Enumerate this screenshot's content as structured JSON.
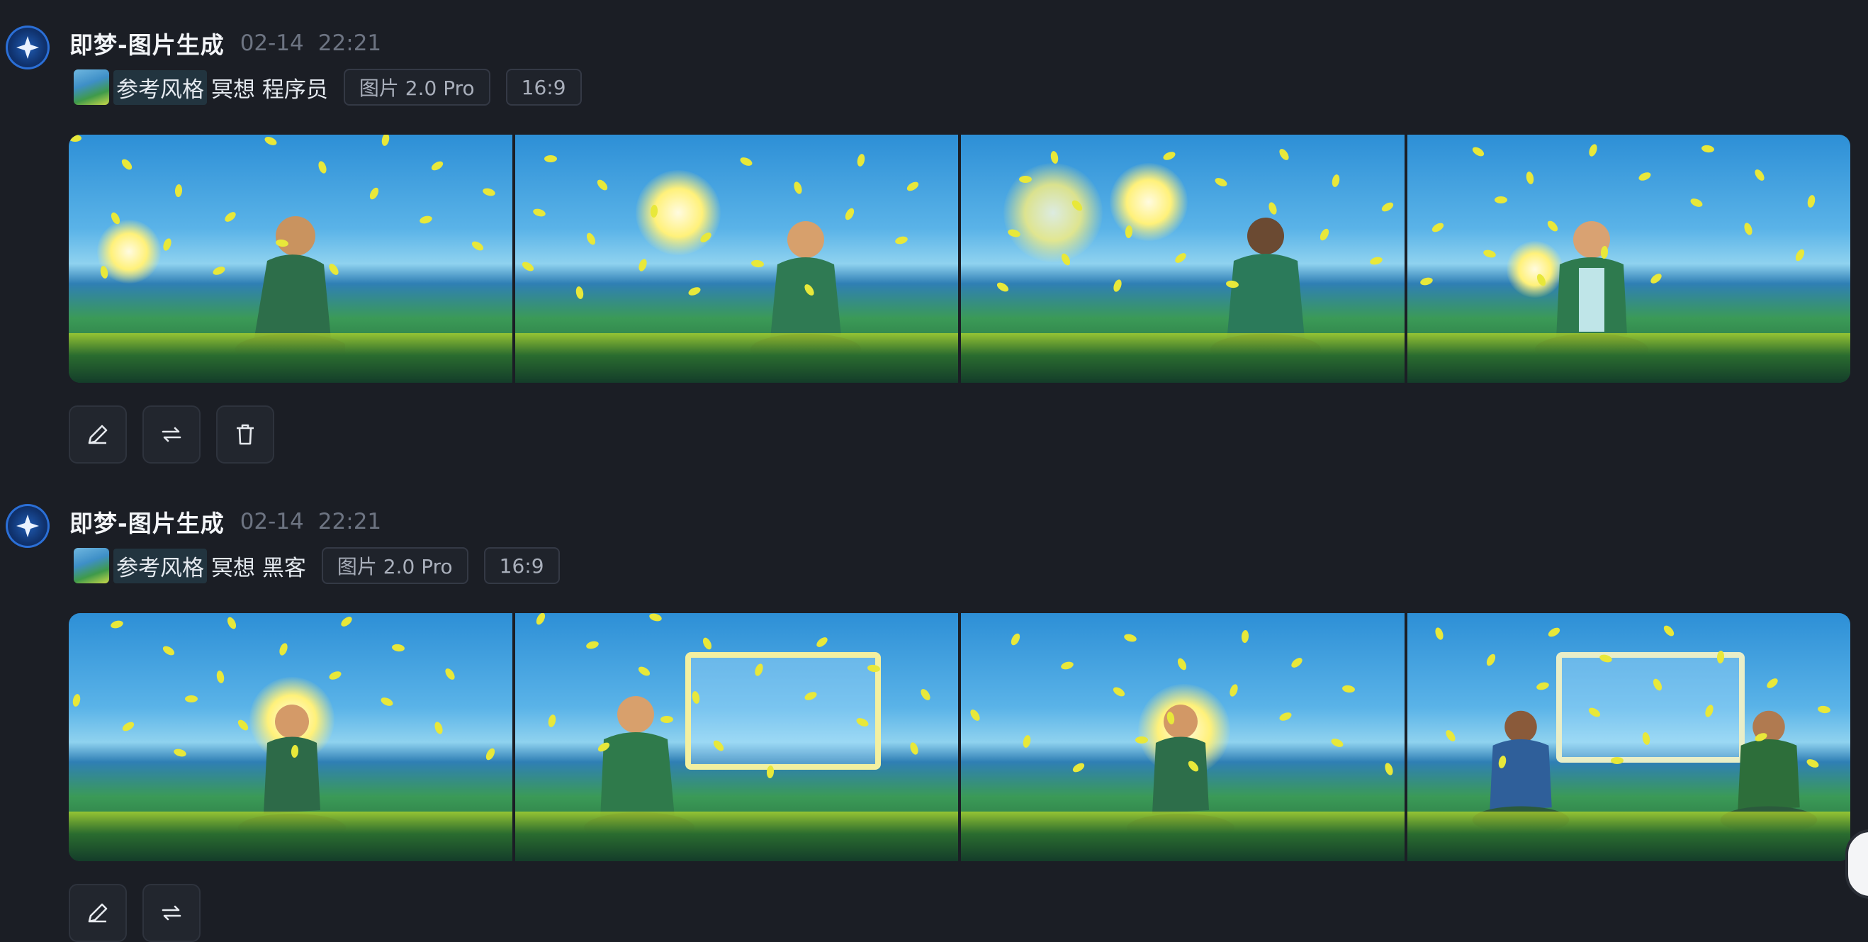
{
  "messages": [
    {
      "title": "即梦-图片生成",
      "date": "02-14",
      "time": "22:21",
      "style_chip": "参考风格",
      "prompt": "冥想 程序员",
      "model_tag": "图片 2.0 Pro",
      "ratio_tag": "16:9",
      "actions": [
        "edit-icon",
        "regenerate-icon",
        "delete-icon"
      ]
    },
    {
      "title": "即梦-图片生成",
      "date": "02-14",
      "time": "22:21",
      "style_chip": "参考风格",
      "prompt": "冥想 黑客",
      "model_tag": "图片 2.0 Pro",
      "ratio_tag": "16:9",
      "actions": [
        "edit-icon",
        "regenerate-icon"
      ]
    }
  ],
  "colors": {
    "background": "#1b1e25",
    "accent": "#2b6fd6",
    "tag_border": "#343945"
  }
}
